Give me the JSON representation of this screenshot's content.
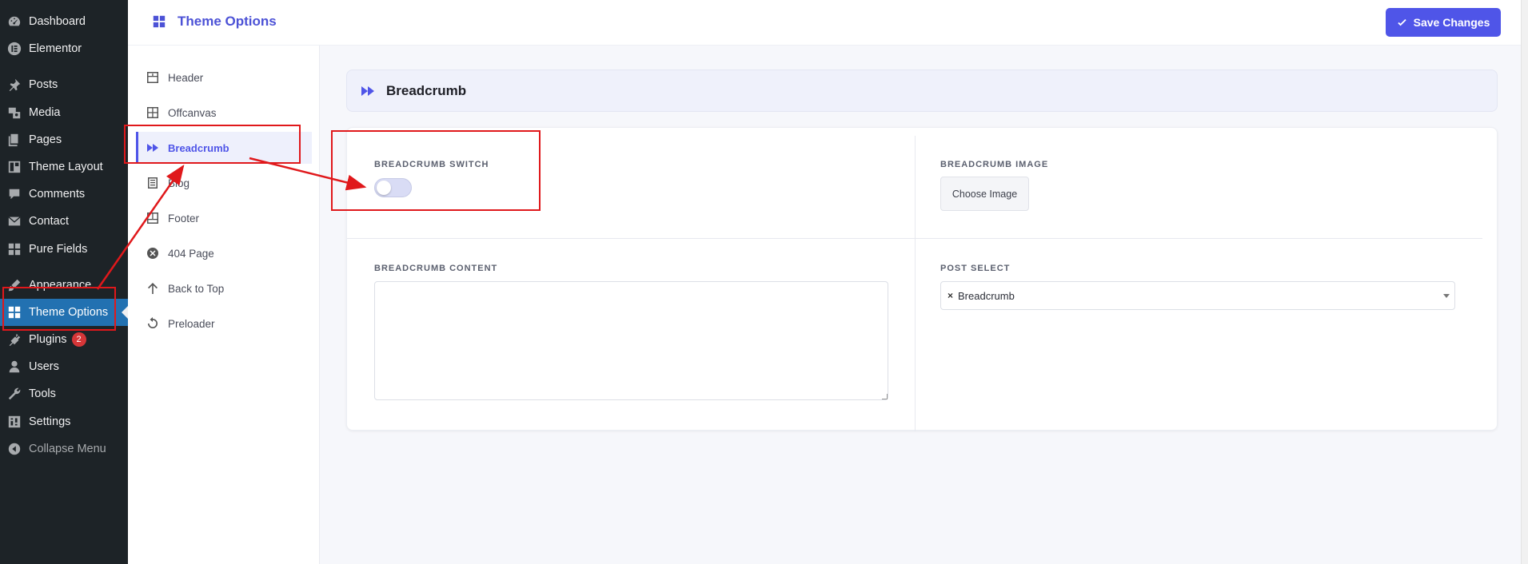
{
  "wp_menu": {
    "items": [
      {
        "label": "Dashboard",
        "icon": "dashboard-icon"
      },
      {
        "label": "Elementor",
        "icon": "elementor-icon"
      },
      {
        "label": "Posts",
        "icon": "pin-icon"
      },
      {
        "label": "Media",
        "icon": "media-icon"
      },
      {
        "label": "Pages",
        "icon": "pages-icon"
      },
      {
        "label": "Theme Layout",
        "icon": "layout-icon"
      },
      {
        "label": "Comments",
        "icon": "comment-icon"
      },
      {
        "label": "Contact",
        "icon": "mail-icon"
      },
      {
        "label": "Pure Fields",
        "icon": "grid-icon"
      },
      {
        "label": "Appearance",
        "icon": "brush-icon"
      },
      {
        "label": "Theme Options",
        "icon": "grid-icon"
      },
      {
        "label": "Plugins",
        "icon": "plugin-icon",
        "badge": "2"
      },
      {
        "label": "Users",
        "icon": "user-icon"
      },
      {
        "label": "Tools",
        "icon": "wrench-icon"
      },
      {
        "label": "Settings",
        "icon": "settings-icon"
      },
      {
        "label": "Collapse Menu",
        "icon": "collapse-icon"
      }
    ]
  },
  "header": {
    "title": "Theme Options",
    "save_label": "Save Changes"
  },
  "options_nav": {
    "items": [
      {
        "label": "Header"
      },
      {
        "label": "Offcanvas"
      },
      {
        "label": "Breadcrumb"
      },
      {
        "label": "Blog"
      },
      {
        "label": "Footer"
      },
      {
        "label": "404 Page"
      },
      {
        "label": "Back to Top"
      },
      {
        "label": "Preloader"
      }
    ],
    "active": "Breadcrumb"
  },
  "section": {
    "title": "Breadcrumb",
    "fields": {
      "switch_label": "BREADCRUMB SWITCH",
      "switch_on": false,
      "image_label": "BREADCRUMB IMAGE",
      "choose_image": "Choose Image",
      "content_label": "BREADCRUMB CONTENT",
      "content_value": "",
      "post_select_label": "POST SELECT",
      "post_select_value": "Breadcrumb"
    }
  },
  "colors": {
    "accent": "#4f55e8",
    "wp_sidebar": "#1d2327",
    "wp_active": "#2271b1",
    "annotation_red": "#e0181b"
  }
}
